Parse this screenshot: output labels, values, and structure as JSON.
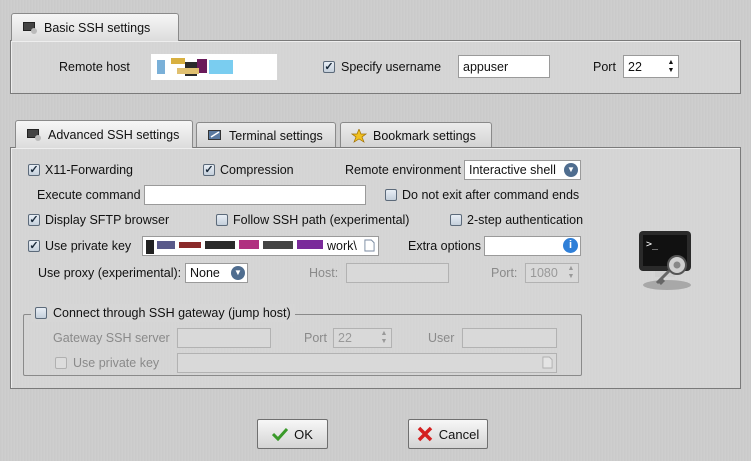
{
  "basic": {
    "tab_label": "Basic SSH settings",
    "remote_host_label": "Remote host",
    "specify_username_label": "Specify username",
    "specify_username_checked": true,
    "username_value": "appuser",
    "port_label": "Port",
    "port_value": "22"
  },
  "tabs": [
    {
      "label": "Advanced SSH settings",
      "icon": "terminal-icon"
    },
    {
      "label": "Terminal settings",
      "icon": "terminal-screen-icon"
    },
    {
      "label": "Bookmark settings",
      "icon": "star-icon"
    }
  ],
  "advanced": {
    "x11_label": "X11-Forwarding",
    "x11_checked": true,
    "compression_label": "Compression",
    "compression_checked": true,
    "remote_env_label": "Remote environment",
    "remote_env_value": "Interactive shell",
    "execute_command_label": "Execute command",
    "execute_command_value": "",
    "do_not_exit_label": "Do not exit after command ends",
    "do_not_exit_checked": false,
    "sftp_label": "Display SFTP browser",
    "sftp_checked": true,
    "follow_path_label": "Follow SSH path (experimental)",
    "follow_path_checked": false,
    "twostep_label": "2-step authentication",
    "twostep_checked": false,
    "private_key_label": "Use private key",
    "private_key_checked": true,
    "private_key_value_suffix": "work\\",
    "extra_options_label": "Extra options",
    "extra_options_value": "",
    "proxy_label": "Use proxy (experimental):",
    "proxy_value": "None",
    "host_label": "Host:",
    "host_value": "",
    "proxy_port_label": "Port:",
    "proxy_port_value": "1080"
  },
  "gateway": {
    "title": "Connect through SSH gateway (jump host)",
    "checked": false,
    "server_label": "Gateway SSH server",
    "server_value": "",
    "port_label": "Port",
    "port_value": "22",
    "user_label": "User",
    "user_value": "",
    "private_key_label": "Use private key",
    "private_key_checked": false
  },
  "buttons": {
    "ok": "OK",
    "cancel": "Cancel"
  },
  "colors": {
    "ok_check": "#3a9a2a",
    "cancel_x": "#d42020",
    "info": "#2f7fd8"
  }
}
